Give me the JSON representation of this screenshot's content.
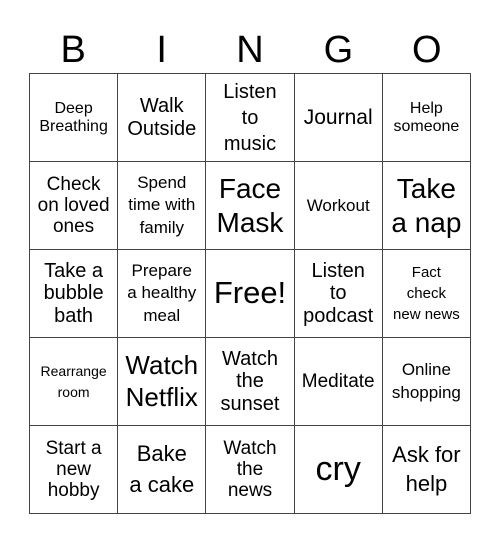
{
  "header": {
    "letters": [
      "B",
      "I",
      "N",
      "G",
      "O"
    ]
  },
  "cells": [
    [
      "Deep\nBreathing",
      "Walk\nOutside",
      "Listen\nto\nmusic",
      "Journal",
      "Help\nsomeone"
    ],
    [
      "Check\non loved\nones",
      "Spend\ntime with\nfamily",
      "Face\nMask",
      "Workout",
      "Take\na nap"
    ],
    [
      "Take a\nbubble\nbath",
      "Prepare\na healthy\nmeal",
      "Free!",
      "Listen\nto\npodcast",
      "Fact\ncheck\nnew news"
    ],
    [
      "Rearrange\nroom",
      "Watch\nNetflix",
      "Watch\nthe\nsunset",
      "Meditate",
      "Online\nshopping"
    ],
    [
      "Start a\nnew\nhobby",
      "Bake\na cake",
      "Watch\nthe\nnews",
      "cry",
      "Ask for\nhelp"
    ]
  ]
}
